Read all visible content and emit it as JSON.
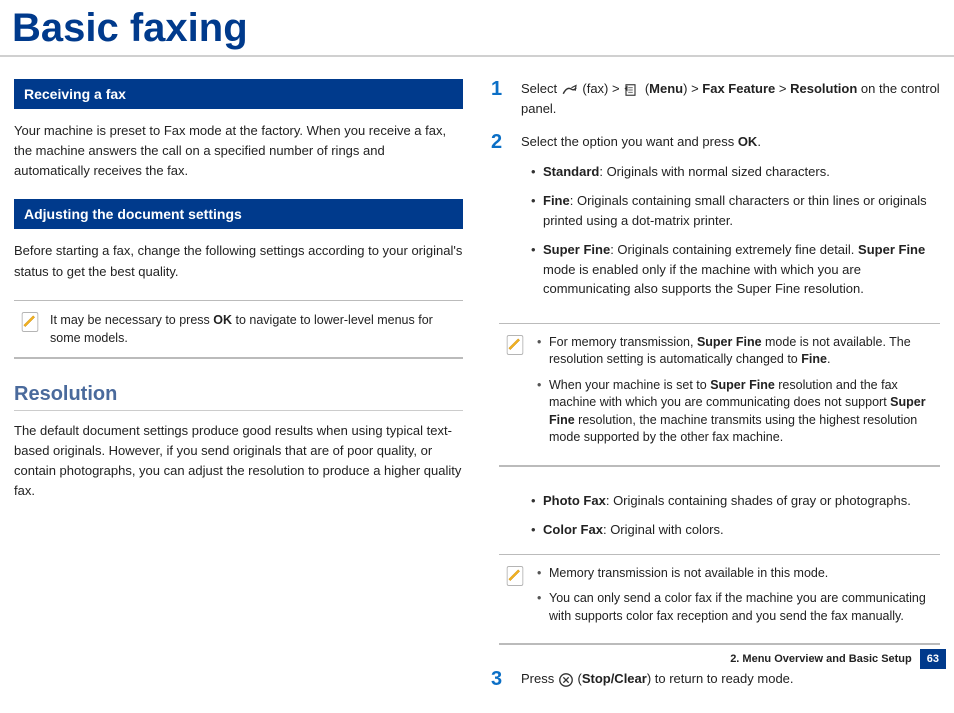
{
  "title": "Basic faxing",
  "left": {
    "section1": {
      "heading": "Receiving a fax",
      "body": "Your machine is preset to Fax mode at the factory. When you receive a fax, the machine answers the call on a specified number of rings and automatically receives the fax."
    },
    "section2": {
      "heading": "Adjusting the document settings",
      "body": "Before starting a fax, change the following settings according to your original's status to get the best quality."
    },
    "note1": {
      "pre": "It may be necessary to press ",
      "bold": "OK",
      "post": " to navigate to lower-level menus for some models."
    },
    "resolution": {
      "heading": "Resolution",
      "body": "The default document settings produce good results when using typical text-based originals. However, if you send originals that are of poor quality, or contain photographs, you can adjust the resolution to produce a higher quality fax."
    }
  },
  "right": {
    "step1": {
      "num": "1",
      "t1": "Select ",
      "fax": "(fax)",
      "gt1": " > ",
      "menu": "Menu",
      "gt2": " > ",
      "faxfeature": "Fax Feature",
      "gt3": " > ",
      "reso": "Resolution",
      "tail": " on the control panel."
    },
    "step2": {
      "num": "2",
      "t1": "Select the option you want and press ",
      "ok": "OK",
      "dot": ".",
      "options": {
        "standard": {
          "b": "Standard",
          "rest": ": Originals with normal sized characters."
        },
        "fine": {
          "b": "Fine",
          "rest": ": Originals containing small characters or thin lines or originals printed using a dot-matrix printer."
        },
        "superfine": {
          "b": "Super Fine",
          "rest1": ": Originals containing extremely fine detail. ",
          "b2": "Super Fine",
          "rest2": " mode is enabled only if the machine with which you are communicating also supports the Super Fine resolution."
        }
      }
    },
    "note2": {
      "i1": {
        "pre": "For memory transmission, ",
        "b1": "Super Fine",
        "mid": " mode is not available. The resolution setting is automatically changed to ",
        "b2": "Fine",
        "post": "."
      },
      "i2": {
        "pre": "When your machine is set to ",
        "b1": "Super Fine",
        "mid": " resolution and the fax machine with which you are communicating does not support ",
        "b2": "Super Fine",
        "post": " resolution, the machine transmits using the highest resolution mode supported by the other fax machine."
      }
    },
    "options_more": {
      "photofax": {
        "b": "Photo Fax",
        "rest": ": Originals containing shades of gray or photographs."
      },
      "colorfax": {
        "b": "Color Fax",
        "rest": ": Original with colors."
      }
    },
    "note3": {
      "i1": "Memory transmission is not available in this mode.",
      "i2": "You can only send a color fax if the machine you are communicating with supports color fax reception and you send the fax manually."
    },
    "step3": {
      "num": "3",
      "t1": "Press ",
      "stopclear": "Stop/Clear",
      "tail": ") to return to ready mode.",
      "open_paren": "("
    }
  },
  "footer": {
    "chapter": "2. Menu Overview and Basic Setup",
    "page": "63"
  }
}
